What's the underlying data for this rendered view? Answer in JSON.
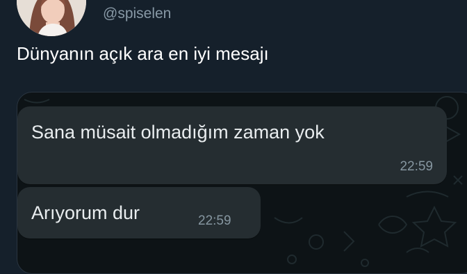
{
  "tweet": {
    "handle": "@spiselen",
    "text": "Dünyanın açık ara en iyi mesajı"
  },
  "chat": {
    "messages": [
      {
        "text": "Sana müsait olmadığım zaman yok",
        "time": "22:59"
      },
      {
        "text": "Arıyorum dur",
        "time": "22:59"
      }
    ]
  },
  "colors": {
    "background": "#15202b",
    "chat_background": "#0d1316",
    "bubble": "#252d31",
    "handle": "#8899a6"
  },
  "icons": [
    "profile-avatar"
  ]
}
